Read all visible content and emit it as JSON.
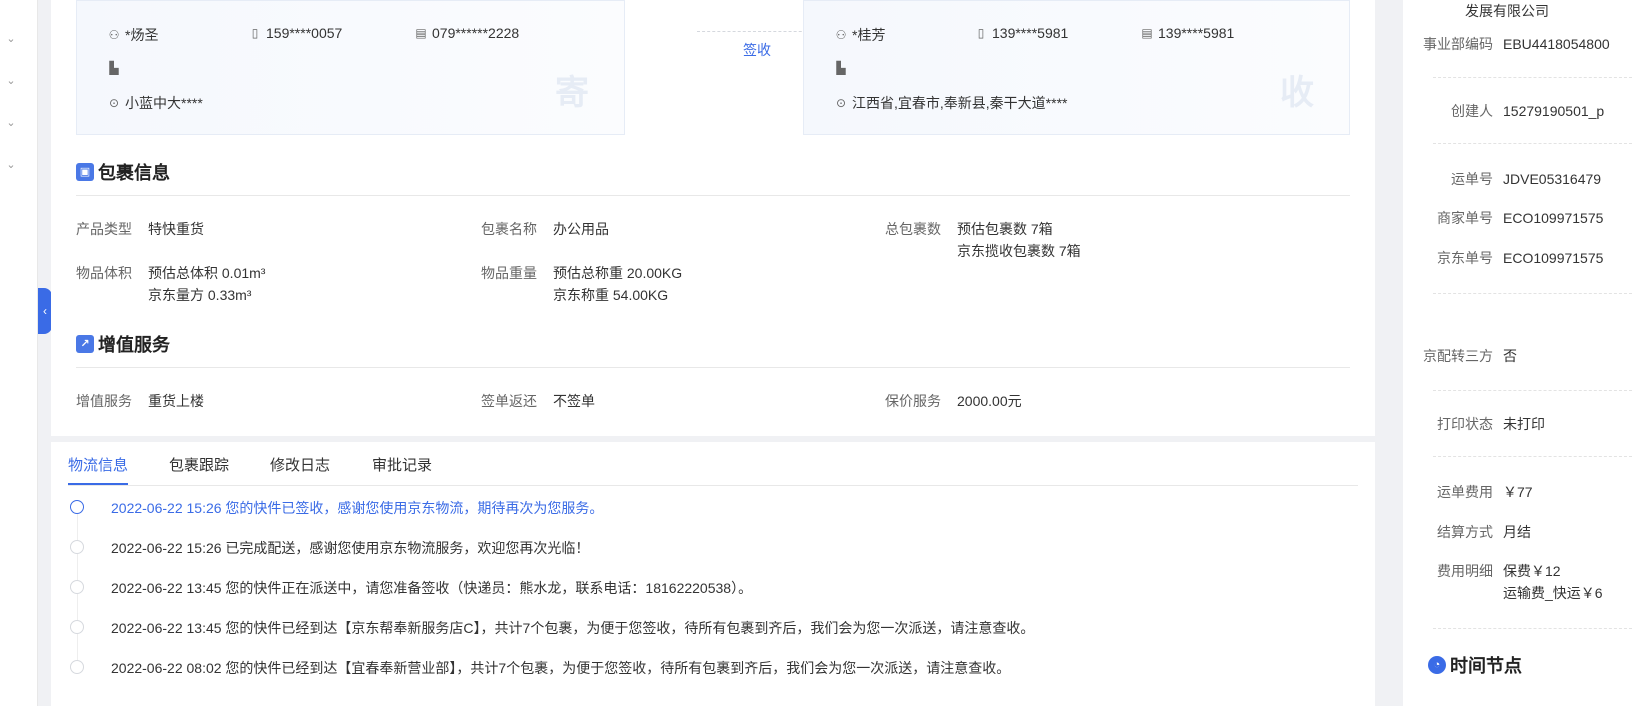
{
  "sender": {
    "name": "*炀圣",
    "mobile": "159****0057",
    "phone": "079******2228",
    "address": "小蓝中大****",
    "badge": "寄"
  },
  "receiver": {
    "name": "*桂芳",
    "mobile": "139****5981",
    "phone": "139****5981",
    "address": "江西省,宜春市,奉新县,秦干大道****",
    "badge": "收"
  },
  "sign_label": "签收",
  "package": {
    "title": "包裹信息",
    "product_type_label": "产品类型",
    "product_type": "特快重货",
    "package_name_label": "包裹名称",
    "package_name": "办公用品",
    "total_label": "总包裹数",
    "total_est": "预估包裹数 7箱",
    "total_jd": "京东揽收包裹数 7箱",
    "volume_label": "物品体积",
    "volume_est": "预估总体积 0.01m³",
    "volume_jd": "京东量方 0.33m³",
    "weight_label": "物品重量",
    "weight_est": "预估总称重 20.00KG",
    "weight_jd": "京东称重 54.00KG"
  },
  "value_added": {
    "title": "增值服务",
    "service_label": "增值服务",
    "service": "重货上楼",
    "return_label": "签单返还",
    "return": "不签单",
    "insurance_label": "保价服务",
    "insurance": "2000.00元"
  },
  "tabs": [
    "物流信息",
    "包裹跟踪",
    "修改日志",
    "审批记录"
  ],
  "timeline": [
    "2022-06-22 15:26 您的快件已签收，感谢您使用京东物流，期待再次为您服务。",
    "2022-06-22 15:26 已完成配送，感谢您使用京东物流服务，欢迎您再次光临！",
    "2022-06-22 13:45 您的快件正在派送中，请您准备签收（快递员：熊水龙，联系电话：18162220538）。",
    "2022-06-22 13:45 您的快件已经到达【京东帮奉新服务店C】，共计7个包裹，为便于您签收，待所有包裹到齐后，我们会为您一次派送，请注意查收。",
    "2022-06-22 08:02 您的快件已经到达【宜春奉新营业部】，共计7个包裹，为便于您签收，待所有包裹到齐后，我们会为您一次派送，请注意查收。"
  ],
  "right_panel": {
    "company_tail": "发展有限公司",
    "rows": [
      {
        "label": "事业部编码",
        "value": "EBU4418054800"
      },
      {
        "label": "创建人",
        "value": "15279190501_p"
      },
      {
        "label": "运单号",
        "value": "JDVE05316479"
      },
      {
        "label": "商家单号",
        "value": "ECO109971575"
      },
      {
        "label": "京东单号",
        "value": "ECO109971575"
      },
      {
        "label": "京配转三方",
        "value": "否"
      },
      {
        "label": "打印状态",
        "value": "未打印"
      },
      {
        "label": "运单费用",
        "value": "￥77"
      },
      {
        "label": "结算方式",
        "value": "月结"
      },
      {
        "label": "费用明细",
        "value": "保费￥12"
      }
    ],
    "fee_detail_2": "运输费_快运￥6",
    "time_title": "时间节点"
  },
  "watermark_text": "15279190501_p"
}
